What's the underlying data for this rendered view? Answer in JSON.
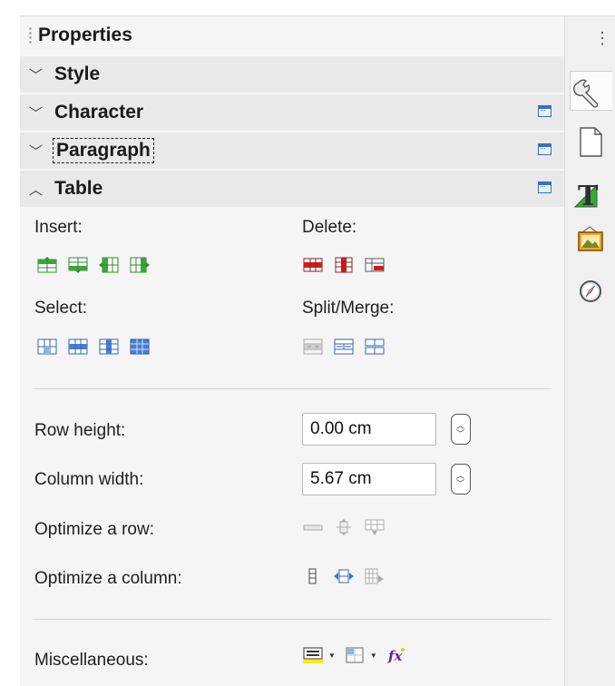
{
  "panel": {
    "title": "Properties"
  },
  "sections": {
    "style": {
      "label": "Style"
    },
    "character": {
      "label": "Character"
    },
    "paragraph": {
      "label": "Paragraph"
    },
    "table": {
      "label": "Table"
    }
  },
  "table": {
    "insert_label": "Insert:",
    "delete_label": "Delete:",
    "select_label": "Select:",
    "split_merge_label": "Split/Merge:",
    "row_height_label": "Row height:",
    "row_height_value": "0.00 cm",
    "column_width_label": "Column width:",
    "column_width_value": "5.67 cm",
    "optimize_row_label": "Optimize a row:",
    "optimize_column_label": "Optimize a column:",
    "misc_label": "Miscellaneous:"
  },
  "sidebar_tabs": [
    "properties-icon",
    "page-icon",
    "styles-icon",
    "gallery-icon",
    "navigator-icon"
  ],
  "colors": {
    "accent": "#3b6fc1",
    "insert_green": "#3aa63a",
    "delete_red": "#d11b1b",
    "select_blue": "#4a7fd0"
  }
}
